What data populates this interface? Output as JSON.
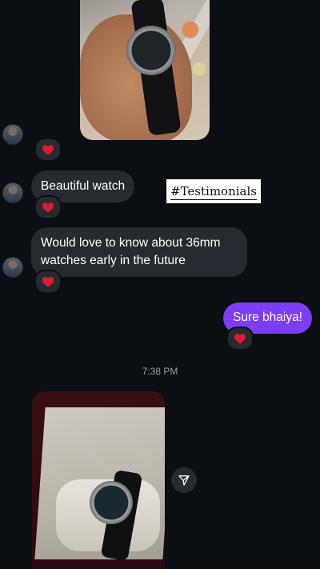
{
  "messages": {
    "beautiful_watch": "Beautiful watch",
    "watches_36mm": "Would love to know about 36mm\nwatches early in the future",
    "sure_bhaiya": "Sure bhaiya!"
  },
  "timestamp": "7:38 PM",
  "overlay_tag": "#Testimonials",
  "reaction_emoji": "heart-icon",
  "colors": {
    "background": "#0b0e13",
    "incoming_bubble": "#262a31",
    "outgoing_bubble": "#7d3cf6",
    "heart": "#e0192f"
  }
}
